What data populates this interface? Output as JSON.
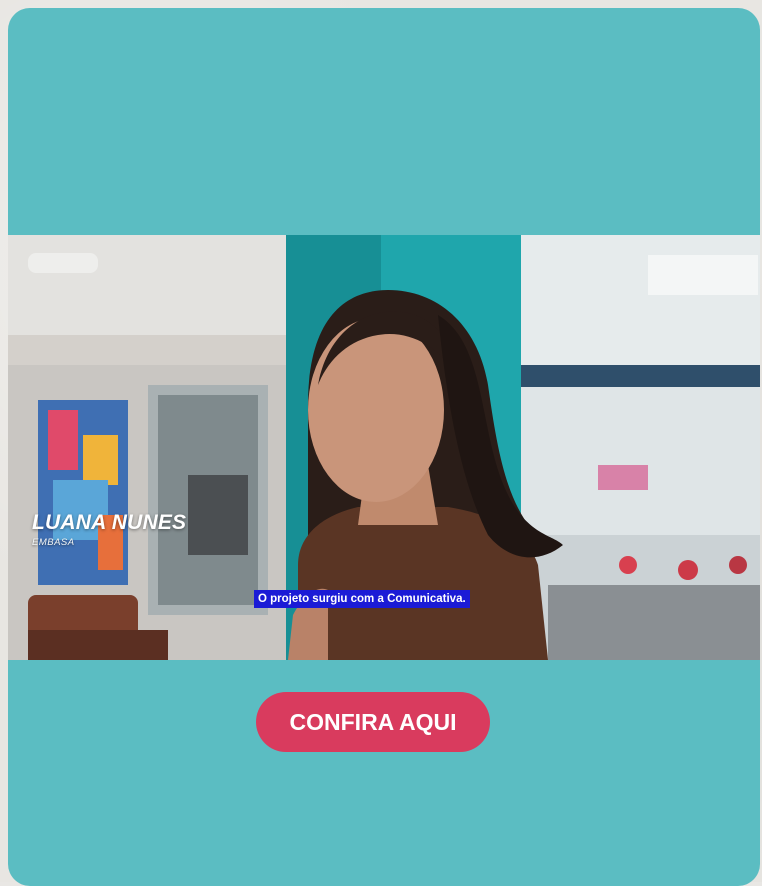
{
  "video": {
    "lower_third": {
      "name": "LUANA NUNES",
      "organization": "EMBASA"
    },
    "subtitle": "O projeto surgiu com a Comunicativa."
  },
  "cta": {
    "label": "CONFIRA AQUI"
  },
  "colors": {
    "card_background": "#5bbdc2",
    "cta_background": "#d93b5e",
    "subtitle_background": "#1b1bd6"
  }
}
